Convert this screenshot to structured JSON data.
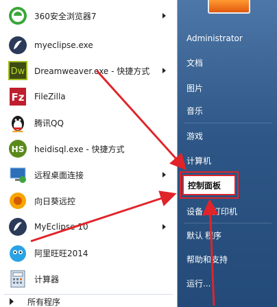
{
  "programs": [
    {
      "label": "360安全浏览器7",
      "icon": "360-browser-icon",
      "submenu": true
    },
    {
      "label": "myeclipse.exe",
      "icon": "myeclipse-icon",
      "submenu": false
    },
    {
      "label": "Dreamweaver.exe - 快捷方式",
      "icon": "dreamweaver-icon",
      "submenu": true
    },
    {
      "label": "FileZilla",
      "icon": "filezilla-icon",
      "submenu": false
    },
    {
      "label": "腾讯QQ",
      "icon": "qq-penguin-icon",
      "submenu": false
    },
    {
      "label": "heidisql.exe - 快捷方式",
      "icon": "heidisql-icon",
      "submenu": false
    },
    {
      "label": "远程桌面连接",
      "icon": "remote-desktop-icon",
      "submenu": true
    },
    {
      "label": "向日葵远控",
      "icon": "sunflower-icon",
      "submenu": false
    },
    {
      "label": "MyEclipse 10",
      "icon": "myeclipse-10-icon",
      "submenu": true
    },
    {
      "label": "阿里旺旺2014",
      "icon": "aliwangwang-icon",
      "submenu": false
    },
    {
      "label": "计算器",
      "icon": "calculator-icon",
      "submenu": false
    }
  ],
  "all_programs": "所有程序",
  "right_menu": {
    "user": "Administrator",
    "documents": "文档",
    "pictures": "图片",
    "music": "音乐",
    "games": "游戏",
    "computer": "计算机",
    "control_panel": "控制面板",
    "devices_printers_a": "设备",
    "devices_printers_b": "打印机",
    "default_programs_a": "默认",
    "default_programs_b": "程序",
    "help_support_a": "帮助",
    "help_support_b": "和支持",
    "run": "运行..."
  },
  "colors": {
    "panel_left": "#ffffff",
    "panel_right": "#2e5686",
    "annotation": "#e0242a"
  }
}
